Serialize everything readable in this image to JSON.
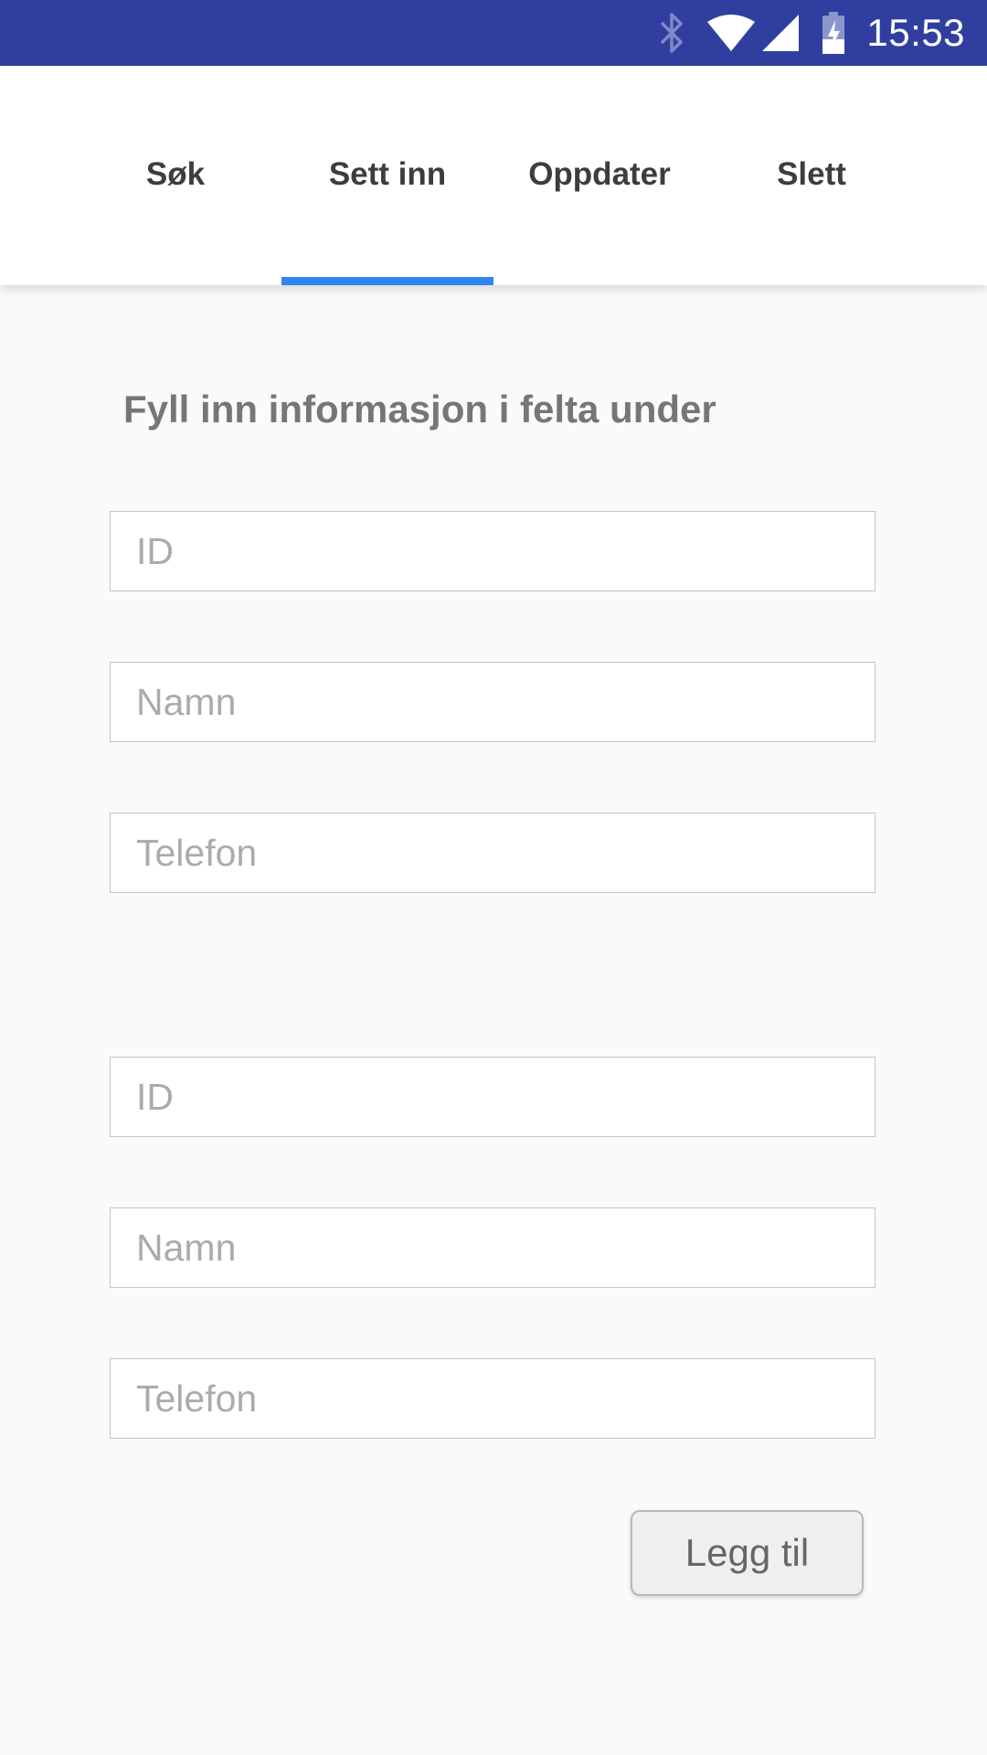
{
  "status_bar": {
    "time": "15:53",
    "icons": [
      "bluetooth-icon",
      "wifi-icon",
      "cell-signal-icon",
      "battery-charging-icon"
    ],
    "background_color": "#303f9f"
  },
  "tabs": [
    {
      "label": "Søk",
      "selected": false
    },
    {
      "label": "Sett inn",
      "selected": true
    },
    {
      "label": "Oppdater",
      "selected": false
    },
    {
      "label": "Slett",
      "selected": false
    }
  ],
  "accent_color": "#2f86f0",
  "form": {
    "heading": "Fyll inn informasjon i felta under",
    "group1": {
      "id_placeholder": "ID",
      "name_placeholder": "Namn",
      "phone_placeholder": "Telefon"
    },
    "group2": {
      "id_placeholder": "ID",
      "name_placeholder": "Namn",
      "phone_placeholder": "Telefon"
    },
    "submit_label": "Legg til"
  }
}
